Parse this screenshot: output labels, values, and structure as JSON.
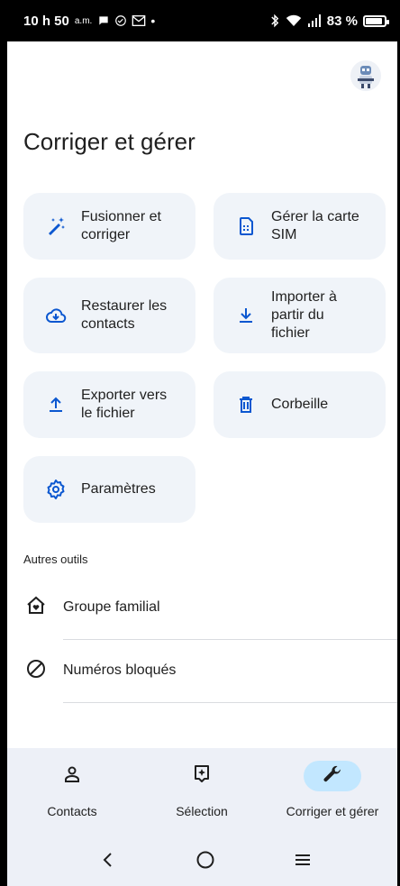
{
  "status_bar": {
    "time": "10 h 50",
    "ampm": "a.m.",
    "battery": "83 %"
  },
  "page": {
    "title": "Corriger et gérer"
  },
  "tiles": [
    {
      "label_line1": "Fusionner et",
      "label_line2": "corriger",
      "icon": "magic-wand-icon"
    },
    {
      "label_line1": "Gérer la carte",
      "label_line2": "SIM",
      "icon": "sim-card-icon"
    },
    {
      "label_line1": "Restaurer les",
      "label_line2": "contacts",
      "icon": "cloud-restore-icon"
    },
    {
      "label_line1": "Importer à",
      "label_line2": "partir du",
      "label_line3": "fichier",
      "icon": "download-icon"
    },
    {
      "label_line1": "Exporter vers",
      "label_line2": "le fichier",
      "icon": "upload-icon"
    },
    {
      "label_line1": "Corbeille",
      "icon": "trash-icon"
    },
    {
      "label_line1": "Paramètres",
      "icon": "gear-icon"
    }
  ],
  "other_tools": {
    "heading": "Autres outils",
    "items": [
      {
        "label": "Groupe familial",
        "icon": "family-home-icon"
      },
      {
        "label": "Numéros bloqués",
        "icon": "block-icon"
      }
    ]
  },
  "bottom_nav": {
    "items": [
      {
        "label": "Contacts",
        "icon": "person-icon",
        "active": false
      },
      {
        "label": "Sélection",
        "icon": "selection-icon",
        "active": false
      },
      {
        "label": "Corriger et gérer",
        "icon": "wrench-icon",
        "active": true
      }
    ]
  },
  "colors": {
    "accent_blue": "#0b57d0",
    "tile_bg": "#f0f4f9",
    "nav_bg": "#edf0f7",
    "active_pill": "#c2e7ff"
  }
}
